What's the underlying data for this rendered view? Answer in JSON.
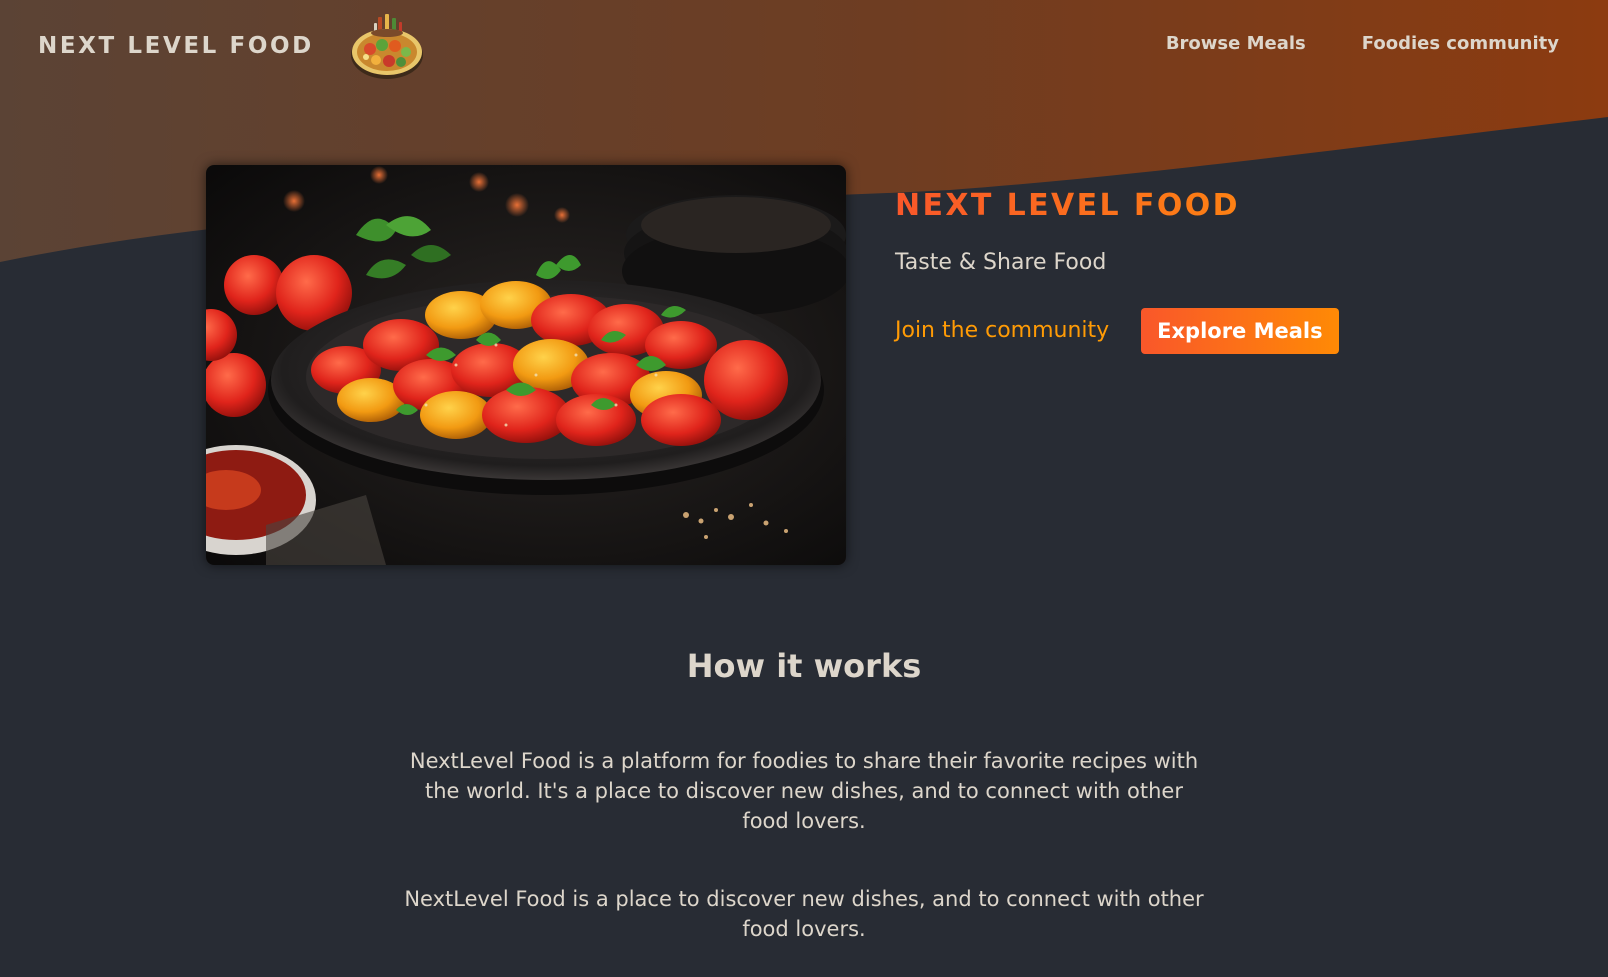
{
  "colors": {
    "background": "#282c34",
    "header_gradient_start": "#5b4335",
    "header_gradient_end": "#8a3d12",
    "accent_orange": "#ff9b05",
    "accent_red": "#f9572a",
    "text": "#ddd6cb"
  },
  "header": {
    "logo_text": "NEXT LEVEL FOOD",
    "logo_icon": "food-platter-icon",
    "nav": [
      {
        "label": "Browse Meals"
      },
      {
        "label": "Foodies community"
      }
    ]
  },
  "hero": {
    "image": "tomato-salad-bowl-image",
    "title": "NEXT LEVEL FOOD",
    "tagline": "Taste & Share Food",
    "community_link": "Join the community",
    "explore_button": "Explore Meals"
  },
  "how_it_works": {
    "heading": "How it works",
    "paragraphs": [
      "NextLevel Food is a platform for foodies to share their favorite recipes with the world. It's a place to discover new dishes, and to connect with other food lovers.",
      "NextLevel Food is a place to discover new dishes, and to connect with other food lovers."
    ]
  }
}
